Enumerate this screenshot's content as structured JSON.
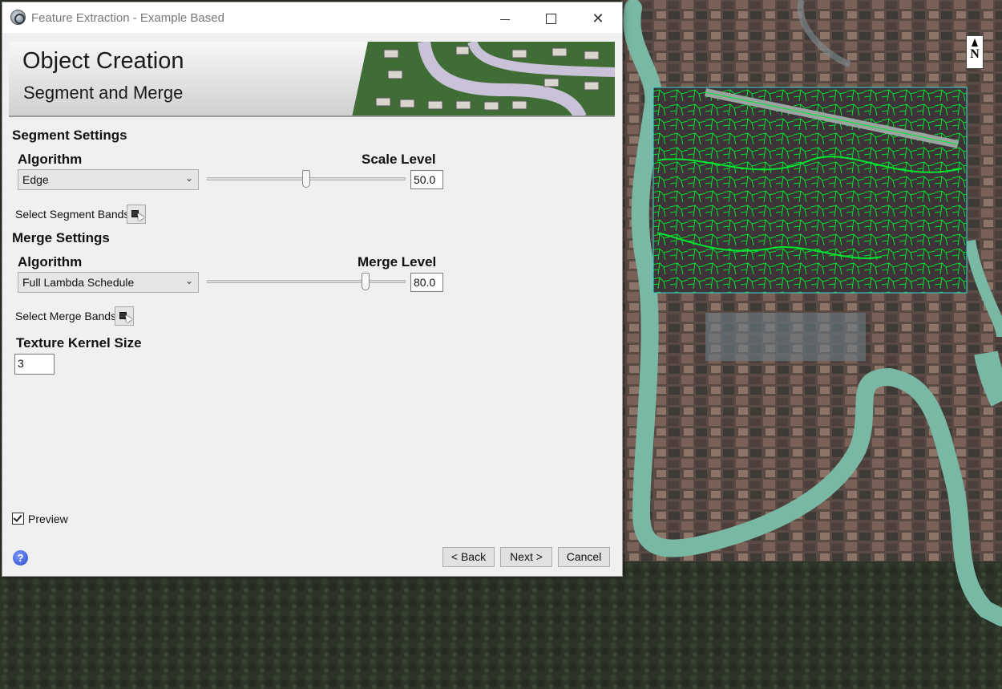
{
  "window": {
    "title": "Feature Extraction - Example Based"
  },
  "banner": {
    "title": "Object Creation",
    "subtitle": "Segment and Merge"
  },
  "segment": {
    "section_title": "Segment Settings",
    "algorithm_label": "Algorithm",
    "algorithm_value": "Edge",
    "level_label": "Scale Level",
    "level_value": "50.0",
    "slider_fraction": 0.5,
    "bands_label": "Select Segment Bands"
  },
  "merge": {
    "section_title": "Merge Settings",
    "algorithm_label": "Algorithm",
    "algorithm_value": "Full Lambda Schedule",
    "level_label": "Merge Level",
    "level_value": "80.0",
    "slider_fraction": 0.8,
    "bands_label": "Select Merge Bands"
  },
  "texture": {
    "label": "Texture Kernel Size",
    "value": "3"
  },
  "preview": {
    "label": "Preview",
    "checked": true
  },
  "buttons": {
    "back": "< Back",
    "next": "Next >",
    "cancel": "Cancel"
  },
  "map": {
    "north_label": "N",
    "segment_outline_color": "#00e62e"
  }
}
